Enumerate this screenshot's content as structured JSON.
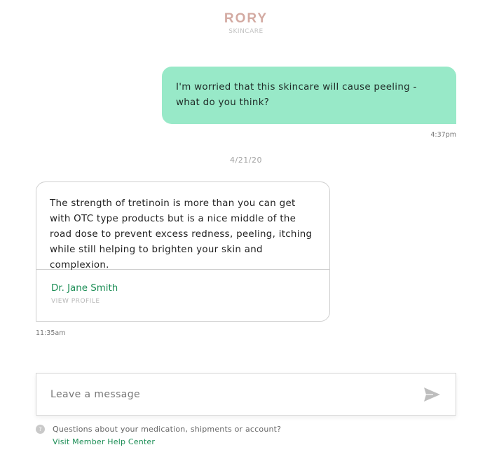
{
  "brand": {
    "name": "RORY",
    "tagline": "SKINCARE"
  },
  "messages": [
    {
      "direction": "outgoing",
      "text": "I'm worried that this skincare will cause peeling - what do you think?",
      "time": "4:37pm"
    },
    {
      "direction": "incoming",
      "date_divider": "4/21/20",
      "text": "The strength of tretinoin is more than you can get with OTC type products but is a nice middle of the road dose to prevent excess redness, peeling, itching while still helping to brighten your skin and complexion.",
      "author": "Dr. Jane Smith",
      "view_profile": "VIEW PROFILE",
      "time": "11:35am"
    }
  ],
  "composer": {
    "placeholder": "Leave a message",
    "send_icon": "send-icon"
  },
  "help": {
    "icon": "help-icon",
    "text": "Questions about your medication, shipments or account?",
    "link": "Visit Member Help Center"
  },
  "colors": {
    "brand": "#d3aaa2",
    "outgoing_bubble": "#98e9c8",
    "accent_green": "#1b8d55"
  }
}
